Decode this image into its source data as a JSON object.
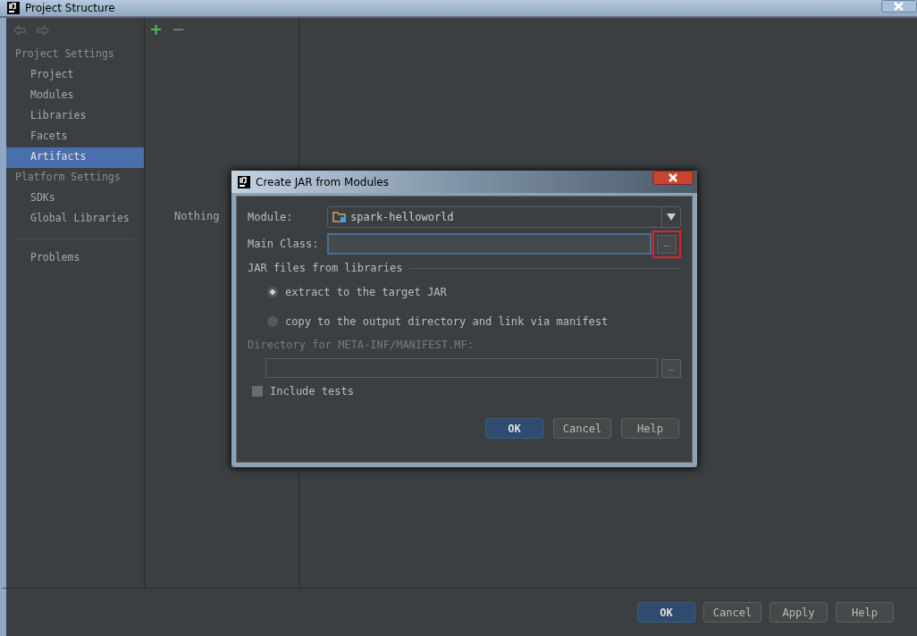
{
  "window": {
    "title": "Project Structure"
  },
  "sidebar": {
    "sections": [
      {
        "heading": "Project Settings",
        "items": [
          {
            "label": "Project",
            "selected": false
          },
          {
            "label": "Modules",
            "selected": false
          },
          {
            "label": "Libraries",
            "selected": false
          },
          {
            "label": "Facets",
            "selected": false
          },
          {
            "label": "Artifacts",
            "selected": true
          }
        ]
      },
      {
        "heading": "Platform Settings",
        "items": [
          {
            "label": "SDKs",
            "selected": false
          },
          {
            "label": "Global Libraries",
            "selected": false
          }
        ]
      }
    ],
    "extra_items": [
      {
        "label": "Problems",
        "selected": false
      }
    ]
  },
  "toolbar": {
    "add": "+",
    "remove": "−"
  },
  "empty_text": "Nothing",
  "dialog": {
    "title": "Create JAR from Modules",
    "module_label": "Module:",
    "module_value": "spark-helloworld",
    "main_class_label": "Main Class:",
    "browse": "...",
    "browse_highlighted": true,
    "libraries_heading": "JAR files from libraries",
    "options": [
      {
        "label": "extract to the target JAR",
        "selected": true
      },
      {
        "label": "copy to the output directory and link via manifest",
        "selected": false
      }
    ],
    "manifest_label": "Directory for META-INF/MANIFEST.MF:",
    "manifest_browse": "...",
    "include_tests": {
      "label": "Include tests",
      "checked": false
    },
    "buttons": [
      {
        "label": "OK",
        "kind": "primary"
      },
      {
        "label": "Cancel",
        "kind": "normal"
      },
      {
        "label": "Help",
        "kind": "normal"
      }
    ]
  },
  "buttons": [
    {
      "label": "OK",
      "kind": "primary"
    },
    {
      "label": "Cancel",
      "kind": "normal"
    },
    {
      "label": "Apply",
      "kind": "normal"
    },
    {
      "label": "Help",
      "kind": "normal"
    }
  ]
}
